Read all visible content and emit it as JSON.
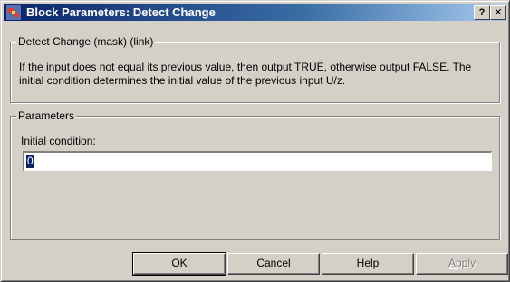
{
  "window": {
    "title": "Block Parameters: Detect Change",
    "help_caption": "?",
    "close_caption": "✕"
  },
  "mask_group": {
    "legend": "Detect Change (mask) (link)",
    "description": "If the input does not equal its previous value, then output TRUE, otherwise output FALSE.  The initial condition determines the initial value of the previous input U/z."
  },
  "parameters_group": {
    "legend": "Parameters",
    "initial_condition_label": "Initial condition:",
    "initial_condition_value": "0"
  },
  "buttons": {
    "ok": {
      "accel": "O",
      "rest": "K"
    },
    "cancel": {
      "accel": "C",
      "rest": "ancel"
    },
    "help": {
      "accel": "H",
      "rest": "elp"
    },
    "apply": {
      "accel": "A",
      "rest": "pply"
    }
  },
  "colors": {
    "title_bar": "#0a246a",
    "face": "#d4d0c8"
  }
}
